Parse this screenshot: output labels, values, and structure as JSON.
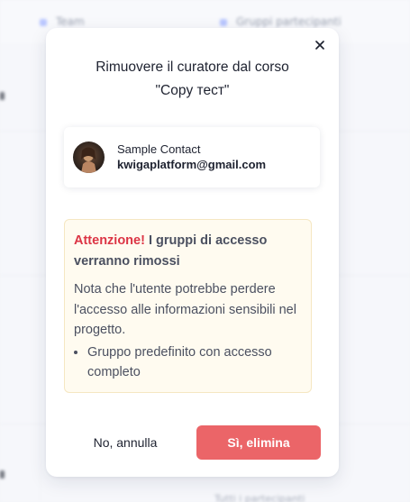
{
  "background": {
    "tabs": [
      "Team",
      "Gruppi partecipanti"
    ],
    "bottom_text": "Tutti i partecipanti"
  },
  "modal": {
    "title_line1": "Rimuovere il curatore dal corso",
    "title_line2": "\"Copy тест\"",
    "close_icon": "close-icon"
  },
  "contact": {
    "name": "Sample Contact",
    "email": "kwigaplatform@gmail.com",
    "avatar_icon": "avatar"
  },
  "warning": {
    "label": "Attenzione!",
    "heading_rest": " I gruppi di accesso verranno rimossi",
    "text": "Nota che l'utente potrebbe perdere l'accesso alle informazioni sensibili nel progetto.",
    "groups": [
      "Gruppo predefinito con accesso completo"
    ]
  },
  "actions": {
    "cancel_label": "No, annulla",
    "confirm_label": "Sì, elimina"
  },
  "colors": {
    "danger": "#dc3545",
    "confirm_button": "#eb6568",
    "warning_bg": "#fffbf0",
    "warning_border": "#f5e7c2"
  }
}
